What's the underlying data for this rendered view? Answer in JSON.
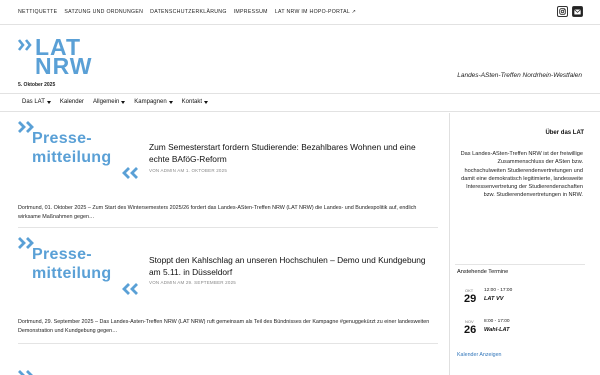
{
  "top_nav": {
    "items": [
      "NETTIQUETTE",
      "SATZUNG UND ORDNUNGEN",
      "DATENSCHUTZERKLÄRUNG",
      "IMPRESSUM",
      "LAT NRW IM HOPO-PORTAL"
    ],
    "icons": [
      "instagram-icon",
      "mail-icon"
    ]
  },
  "header": {
    "logo_line1": "LAT",
    "logo_line2": "NRW",
    "date": "5. Oktober 2025",
    "tagline": "Landes-ASten-Treffen Nordrhein-Westfalen",
    "accent_color": "#5aa0d6"
  },
  "main_nav": {
    "items": [
      {
        "label": "Das LAT",
        "dropdown": true
      },
      {
        "label": "Kalender",
        "dropdown": false
      },
      {
        "label": "Allgemein",
        "dropdown": true
      },
      {
        "label": "Kampagnen",
        "dropdown": true
      },
      {
        "label": "Kontakt",
        "dropdown": true
      }
    ]
  },
  "posts": [
    {
      "thumb_line1": "Presse-",
      "thumb_line2": "mitteilung",
      "title": "Zum Semesterstart fordern Studierende: Bezahlbares Wohnen und eine echte BAföG-Reform",
      "meta": "VON ADMIN AM 1. OKTOBER 2025",
      "excerpt": "Dortmund, 01. Oktober 2025 – Zum Start des Wintersemesters 2025/26 fordert das Landes-ASten-Treffen NRW (LAT NRW) die Landes- und Bundespolitik auf, endlich wirksame Maßnahmen gegen…"
    },
    {
      "thumb_line1": "Presse-",
      "thumb_line2": "mitteilung",
      "title": "Stoppt den Kahlschlag an unseren Hochschulen – Demo und Kundgebung am 5.11. in Düsseldorf",
      "meta": "VON ADMIN AM 29. SEPTEMBER 2025",
      "excerpt": "Dortmund, 29. September 2025 – Das Landes-Asten-Treffen NRW (LAT NRW) ruft gemeinsam als Teil des Bündnisses der Kampagne #genuggekürzt zu einer landesweiten Demonstration und Kundgebung gegen…"
    }
  ],
  "sidebar": {
    "about_title": "Über das LAT",
    "about_text": "Das Landes-ASten-Treffen NRW ist der freiwillige Zusammenschluss der ASten bzw. hochschulweiten Studierendenvertretungen und damit eine demokratisch legitimierte, landesweite Interessenvertretung der Studierendenschaften bzw. Studierendenvertretungen in NRW.",
    "events_title": "Anstehende Termine",
    "events": [
      {
        "month": "OKT",
        "day": "29",
        "time": "12:00 - 17:00",
        "name": "LAT VV"
      },
      {
        "month": "NOV",
        "day": "26",
        "time": "8:00 - 17:00",
        "name": "Wahl-LAT"
      }
    ],
    "calendar_link": "Kalender Anzeigen"
  }
}
